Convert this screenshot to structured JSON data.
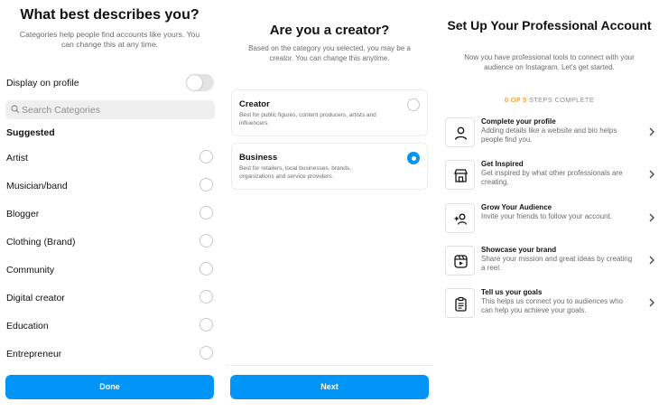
{
  "category_screen": {
    "title": "What best describes you?",
    "subtitle": "Categories help people find accounts like yours. You can change this at any time.",
    "display_on_profile_label": "Display on profile",
    "display_on_profile_enabled": false,
    "search_placeholder": "Search Categories",
    "suggested_heading": "Suggested",
    "categories": [
      "Artist",
      "Musician/band",
      "Blogger",
      "Clothing (Brand)",
      "Community",
      "Digital creator",
      "Education",
      "Entrepreneur"
    ],
    "done_label": "Done"
  },
  "account_type_screen": {
    "title": "Are you a creator?",
    "subtitle": "Based on the category you selected, you may be a creator. You can change this anytime.",
    "options": [
      {
        "title": "Creator",
        "description": "Best for public figures, content producers, artists and influencers.",
        "selected": false
      },
      {
        "title": "Business",
        "description": "Best for retailers, local businesses, brands, organizations and service providers.",
        "selected": true
      }
    ],
    "next_label": "Next"
  },
  "setup_screen": {
    "title": "Set Up Your Professional Account",
    "subtitle": "Now you have professional tools to connect with your audience on Instagram. Let's get started.",
    "steps_count": "0 OF 5",
    "steps_suffix": "STEPS COMPLETE",
    "steps": [
      {
        "title": "Complete your profile",
        "description": "Adding details like a website and bio helps people find you.",
        "icon": "person-icon"
      },
      {
        "title": "Get Inspired",
        "description": "Get inspired by what other professionals are creating.",
        "icon": "shop-icon"
      },
      {
        "title": "Grow Your Audience",
        "description": "Invite your friends to follow your account.",
        "icon": "add-person-icon"
      },
      {
        "title": "Showcase your brand",
        "description": "Share your mission and great ideas by creating a reel.",
        "icon": "reel-icon"
      },
      {
        "title": "Tell us your goals",
        "description": "This helps us connect you to audiences who can help you achieve your goals.",
        "icon": "clipboard-icon"
      }
    ]
  },
  "colors": {
    "accent": "#0095f6",
    "steps_count": "#f7a23b",
    "muted_text": "#6b6b6b"
  }
}
